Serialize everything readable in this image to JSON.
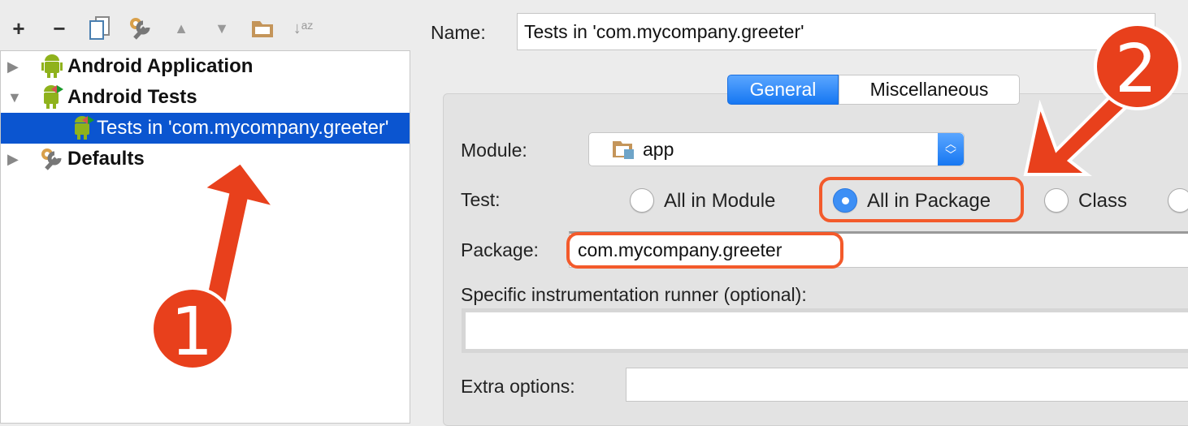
{
  "toolbar": {
    "icons": [
      "plus-icon",
      "minus-icon",
      "copy-icon",
      "wrench-icon",
      "arrow-up-icon",
      "arrow-down-icon",
      "folder-icon",
      "sort-az-icon"
    ]
  },
  "tree": {
    "items": [
      {
        "label": "Android Application",
        "expanded": false
      },
      {
        "label": "Android Tests",
        "expanded": true
      },
      {
        "label": "Tests in 'com.mycompany.greeter'",
        "selected": true
      },
      {
        "label": "Defaults",
        "expanded": false
      }
    ]
  },
  "form": {
    "name_label": "Name:",
    "name_value": "Tests in 'com.mycompany.greeter'",
    "tabs": [
      {
        "label": "General",
        "active": true
      },
      {
        "label": "Miscellaneous",
        "active": false
      }
    ],
    "module_label": "Module:",
    "module_value": "app",
    "test_label": "Test:",
    "test_options": [
      {
        "label": "All in Module",
        "selected": false
      },
      {
        "label": "All in Package",
        "selected": true
      },
      {
        "label": "Class",
        "selected": false
      }
    ],
    "package_label": "Package:",
    "package_value": "com.mycompany.greeter",
    "runner_label": "Specific instrumentation runner (optional):",
    "runner_value": "",
    "extra_label": "Extra options:",
    "extra_value": ""
  },
  "annotations": {
    "one": "1",
    "two": "2",
    "color": "#e8401c",
    "highlight": "#f35a2b"
  },
  "colors": {
    "selection": "#0b55d0",
    "accent": "#3d8ff5"
  }
}
